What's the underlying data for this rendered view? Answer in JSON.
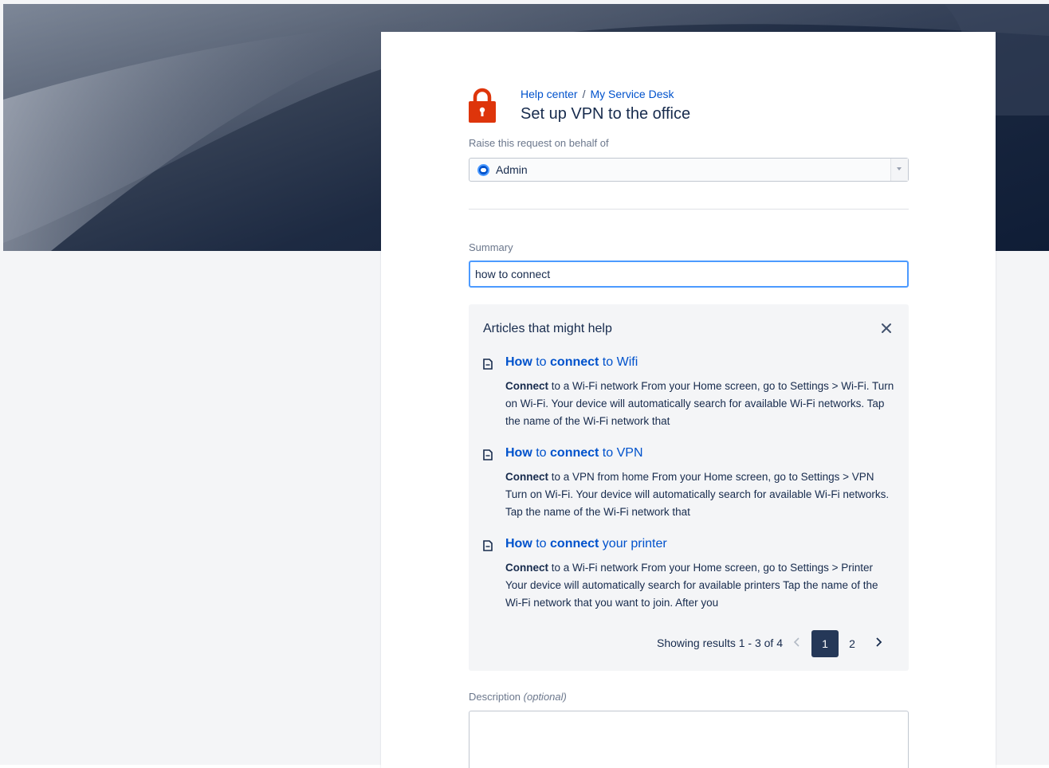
{
  "breadcrumb": {
    "help_center": "Help center",
    "separator": "/",
    "service_desk": "My Service Desk"
  },
  "request": {
    "title": "Set up VPN to the office",
    "icon": "lock-icon",
    "icon_color": "#de350b"
  },
  "behalf": {
    "label": "Raise this request on behalf of",
    "value": "Admin"
  },
  "summary": {
    "label": "Summary",
    "value": "how to connect"
  },
  "articles": {
    "title": "Articles that might help",
    "items": [
      {
        "title_bold_1": "How",
        "title_mid": " to ",
        "title_bold_2": "connect",
        "title_rest": " to Wifi",
        "body_bold": "Connect",
        "body": " to a Wi-Fi network From your Home screen, go to Settings > Wi-Fi. Turn on Wi-Fi. Your device will automatically search for available Wi-Fi networks. Tap the name of the Wi-Fi network that"
      },
      {
        "title_bold_1": "How",
        "title_mid": " to ",
        "title_bold_2": "connect",
        "title_rest": " to VPN",
        "body_bold": "Connect",
        "body": " to a VPN from home From your Home screen, go to Settings > VPN Turn on Wi-Fi. Your device will automatically search for available Wi-Fi networks. Tap the name of the Wi-Fi network that"
      },
      {
        "title_bold_1": "How",
        "title_mid": " to ",
        "title_bold_2": "connect",
        "title_rest": " your printer",
        "body_bold": "Connect",
        "body": " to a Wi-Fi network From your Home screen, go to Settings > Printer  Your device will automatically search for available printers Tap the name of the Wi-Fi network that you want to join. After you"
      }
    ],
    "pagination": {
      "showing": "Showing results 1 - 3 of 4",
      "pages": [
        "1",
        "2"
      ],
      "current": "1"
    }
  },
  "description": {
    "label": "Description",
    "optional": "(optional)",
    "value": ""
  },
  "colors": {
    "link": "#0052cc",
    "focus": "#4c9aff",
    "current_page": "#253858"
  }
}
